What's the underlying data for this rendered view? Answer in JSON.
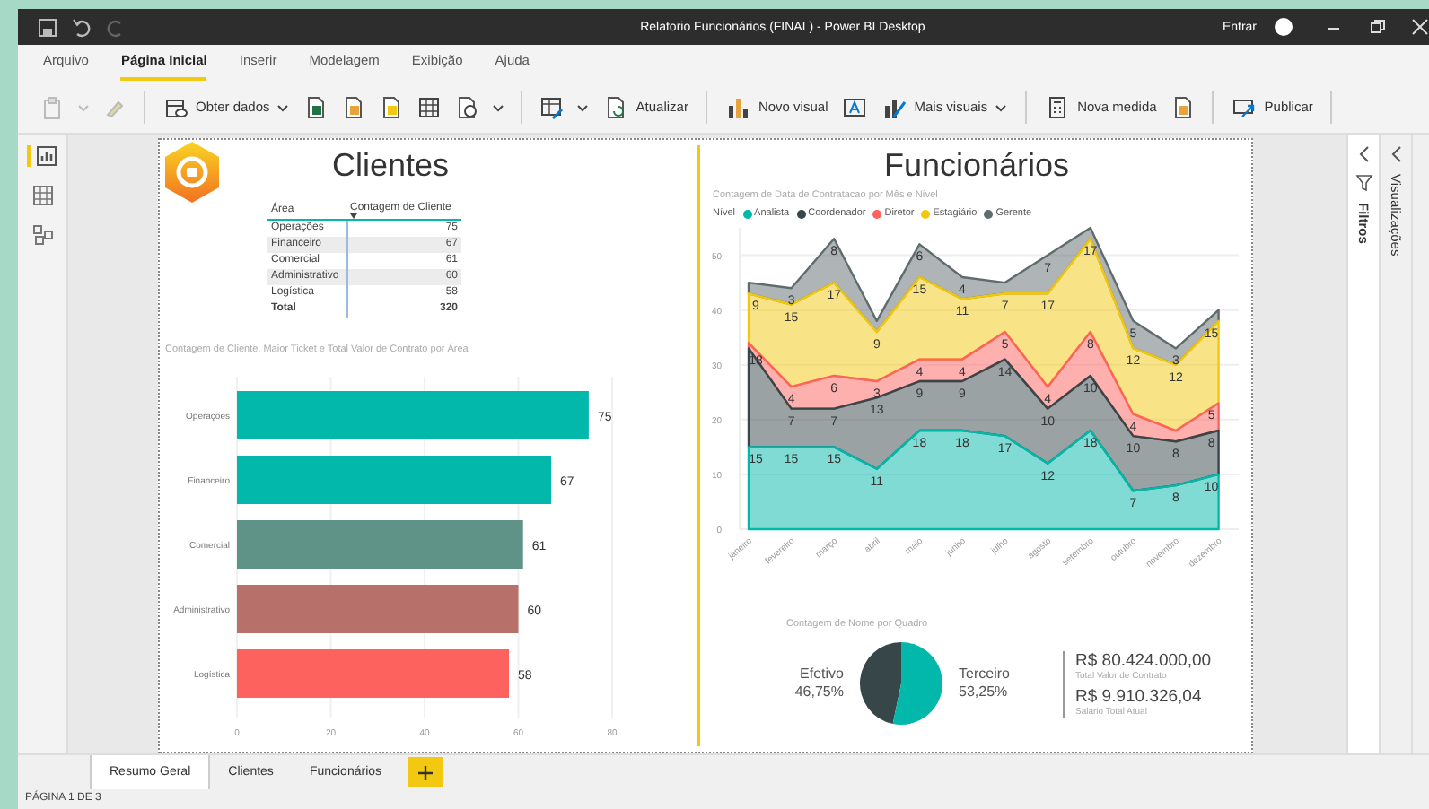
{
  "window": {
    "title": "Relatorio Funcionários (FINAL) - Power BI Desktop",
    "account": "Entrar"
  },
  "menu_tabs": [
    {
      "label": "Arquivo",
      "selected": false
    },
    {
      "label": "Página Inicial",
      "selected": true
    },
    {
      "label": "Inserir",
      "selected": false
    },
    {
      "label": "Modelagem",
      "selected": false
    },
    {
      "label": "Exibição",
      "selected": false
    },
    {
      "label": "Ajuda",
      "selected": false
    }
  ],
  "ribbon": {
    "buttons": [
      "Obter dados",
      "Atualizar",
      "Novo visual",
      "Mais visuais",
      "Nova medida",
      "Publicar"
    ]
  },
  "panes": [
    {
      "title": "Filtros"
    },
    {
      "title": "Visualizações"
    }
  ],
  "report": {
    "clientes": {
      "title": "Clientes",
      "table": {
        "columns": [
          "Área",
          "Contagem de Cliente"
        ],
        "rows": [
          [
            "Operações",
            "75"
          ],
          [
            "Financeiro",
            "67"
          ],
          [
            "Comercial",
            "61"
          ],
          [
            "Administrativo",
            "60"
          ],
          [
            "Logística",
            "58"
          ]
        ],
        "total": [
          "Total",
          "320"
        ]
      },
      "bar_chart": {
        "chart_data": {
          "type": "bar",
          "orientation": "horizontal",
          "title": "Contagem de Cliente, Maior Ticket e Total Valor de Contrato por Área",
          "categories": [
            "Operações",
            "Financeiro",
            "Comercial",
            "Administrativo",
            "Logística"
          ],
          "values": [
            75,
            67,
            61,
            60,
            58
          ],
          "colors": [
            "#01b8aa",
            "#01b8aa",
            "#5f9388",
            "#b8716a",
            "#fd625e"
          ],
          "xlim": [
            0,
            80
          ],
          "xticks": [
            0,
            20,
            40,
            60,
            80
          ],
          "grid": true,
          "data_labels": true
        }
      }
    },
    "funcionarios": {
      "title": "Funcionários",
      "area_chart": {
        "legend_title": "Nível",
        "chart_data": {
          "type": "area",
          "stacked": true,
          "title": "Contagem de Data de Contratacao por Mês e Nível",
          "categories": [
            "janeiro",
            "fevereiro",
            "março",
            "abril",
            "maio",
            "junho",
            "julho",
            "agosto",
            "setembro",
            "outubro",
            "novembro",
            "dezembro"
          ],
          "series": [
            {
              "name": "Analista",
              "color": "#01b8aa",
              "values": [
                15,
                15,
                15,
                11,
                18,
                18,
                17,
                12,
                18,
                7,
                8,
                10
              ],
              "value_labels": [
                "15",
                "15",
                "15",
                "11",
                "18",
                "18",
                "17",
                "12",
                "18",
                "7",
                "8",
                "10"
              ]
            },
            {
              "name": "Coordenador",
              "color": "#374649",
              "values": [
                18,
                7,
                7,
                13,
                9,
                9,
                14,
                10,
                10,
                10,
                8,
                8
              ],
              "value_labels": [
                "18",
                "7",
                "7",
                "13",
                "9",
                "9",
                "14",
                "10",
                "10",
                "10",
                "8",
                "8"
              ]
            },
            {
              "name": "Diretor",
              "color": "#fd625e",
              "values": [
                1,
                4,
                6,
                3,
                4,
                4,
                5,
                4,
                8,
                4,
                2,
                5
              ],
              "value_labels": [
                null,
                "4",
                "6",
                "3",
                "4",
                "4",
                "5",
                "4",
                "8",
                "4",
                null,
                "5"
              ]
            },
            {
              "name": "Estagiário",
              "color": "#f2c80f",
              "values": [
                9,
                15,
                17,
                9,
                15,
                11,
                7,
                17,
                17,
                12,
                12,
                15
              ],
              "value_labels": [
                "9",
                "15",
                "17",
                "9",
                "15",
                "11",
                "7",
                "17",
                "17",
                "12",
                "12",
                "15"
              ]
            },
            {
              "name": "Gerente",
              "color": "#5f6b6d",
              "values": [
                2,
                3,
                8,
                2,
                6,
                4,
                2,
                7,
                2,
                5,
                3,
                2
              ],
              "value_labels": [
                null,
                "3",
                "8",
                null,
                "6",
                "4",
                null,
                "7",
                null,
                "5",
                "3",
                null
              ]
            }
          ],
          "ylim": [
            0,
            55
          ],
          "yticks": [
            0,
            10,
            20,
            30,
            40,
            50
          ],
          "grid": true
        }
      },
      "pie_chart": {
        "chart_data": {
          "type": "pie",
          "title": "Contagem de Nome por Quadro",
          "categories": [
            "Efetivo",
            "Terceiro"
          ],
          "values": [
            46.75,
            53.25
          ],
          "colors": [
            "#374649",
            "#01b8aa"
          ],
          "value_labels": [
            "46,75%",
            "53,25%"
          ]
        }
      },
      "cards": [
        {
          "value": "R$ 80.424.000,00",
          "label": "Total Valor de Contrato"
        },
        {
          "value": "R$ 9.910.326,04",
          "label": "Salario Total Atual"
        }
      ]
    }
  },
  "page_tabs": [
    {
      "label": "Resumo Geral",
      "selected": true
    },
    {
      "label": "Clientes",
      "selected": false
    },
    {
      "label": "Funcionários",
      "selected": false
    }
  ],
  "status_bar": "PÁGINA 1 DE 3"
}
